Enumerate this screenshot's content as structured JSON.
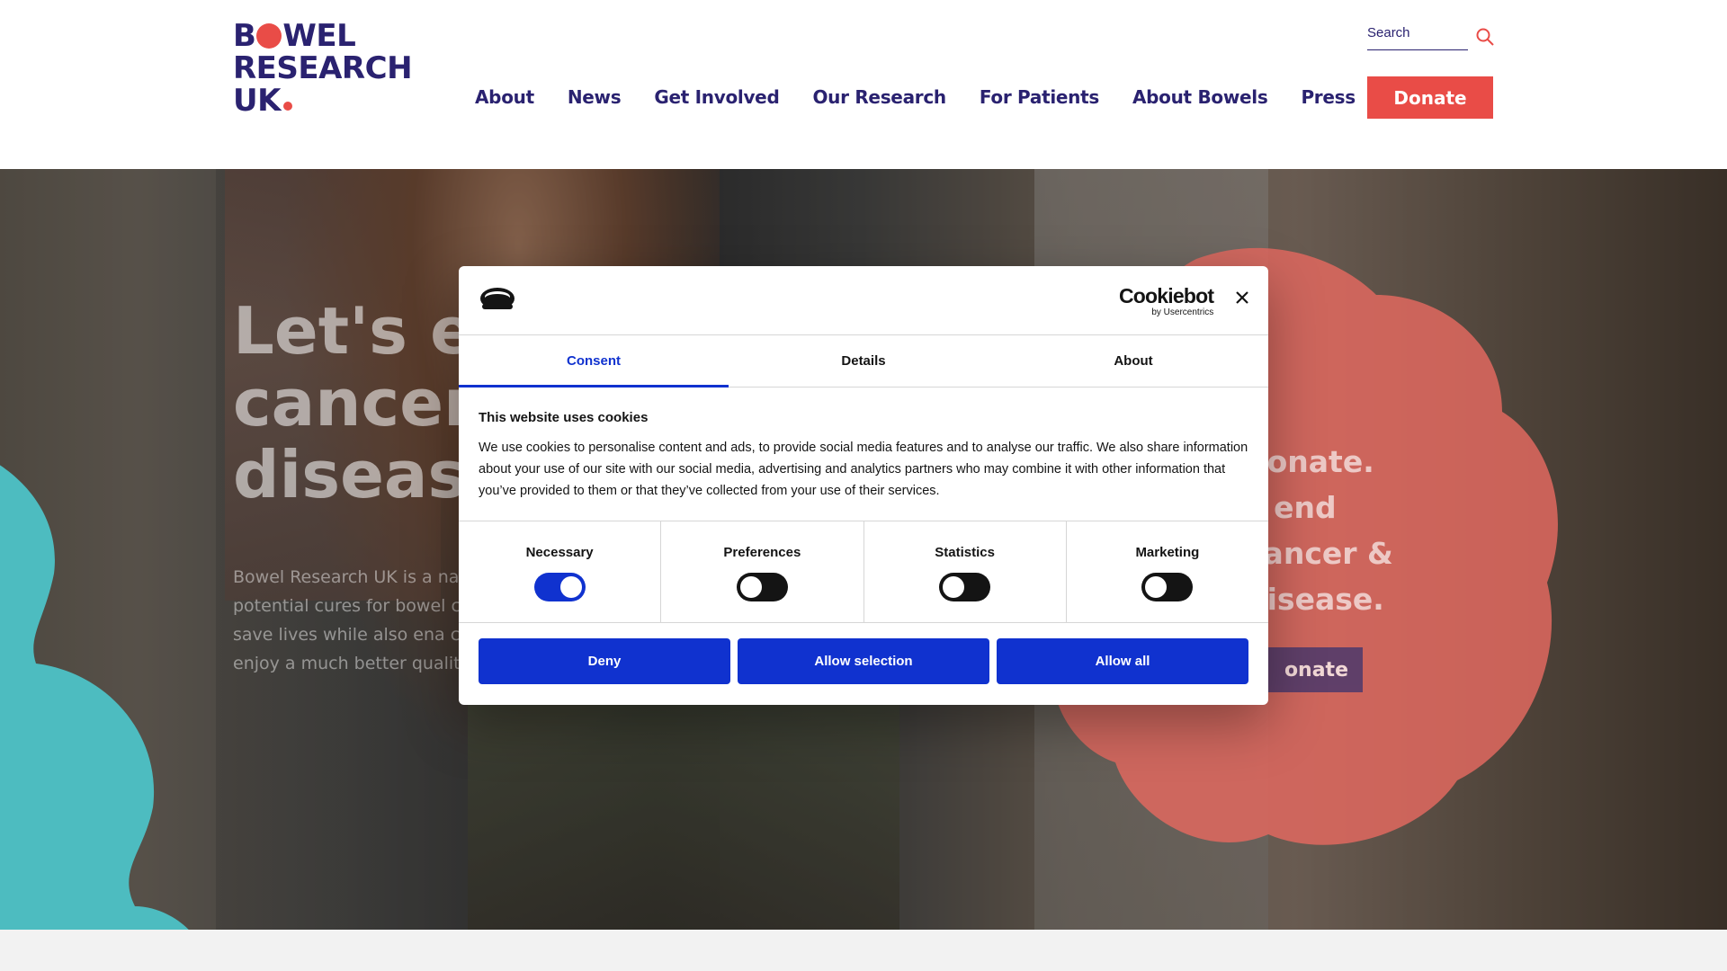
{
  "header": {
    "logo": {
      "line1_a": "B",
      "line1_b": "WEL",
      "line2": "RESEARCH",
      "line3": "UK"
    },
    "nav": [
      "About",
      "News",
      "Get Involved",
      "Our Research",
      "For Patients",
      "About Bowels",
      "Press"
    ],
    "search_placeholder": "Search",
    "donate_label": "Donate"
  },
  "hero": {
    "title": "Let's e\ncancer\ndiseas",
    "text": "Bowel Research UK is a nat charity dedicated to fundi potential cures for bowel c disease and other bowel c to save lives while also ena chronic bowel conditions to enjoy a much better quality of life.",
    "right_text": " donate.\ns end\ncancer &\ndisease.",
    "right_button": "onate"
  },
  "colors": {
    "brand": "#2a2270",
    "accent": "#e94c47",
    "teal": "#4dbcc0",
    "consent_blue": "#1032cf"
  },
  "cookie_dialog": {
    "brand_main": "Cookiebot",
    "brand_sub": "by Usercentrics",
    "tabs": [
      "Consent",
      "Details",
      "About"
    ],
    "active_tab": "Consent",
    "title": "This website uses cookies",
    "text": "We use cookies to personalise content and ads, to provide social media features and to analyse our traffic. We also share information about your use of our site with our social media, advertising and analytics partners who may combine it with other information that you’ve provided to them or that they’ve collected from your use of their services.",
    "categories": [
      {
        "label": "Necessary",
        "enabled": true
      },
      {
        "label": "Preferences",
        "enabled": false
      },
      {
        "label": "Statistics",
        "enabled": false
      },
      {
        "label": "Marketing",
        "enabled": false
      }
    ],
    "buttons": {
      "deny": "Deny",
      "allow_selection": "Allow selection",
      "allow_all": "Allow all"
    }
  }
}
